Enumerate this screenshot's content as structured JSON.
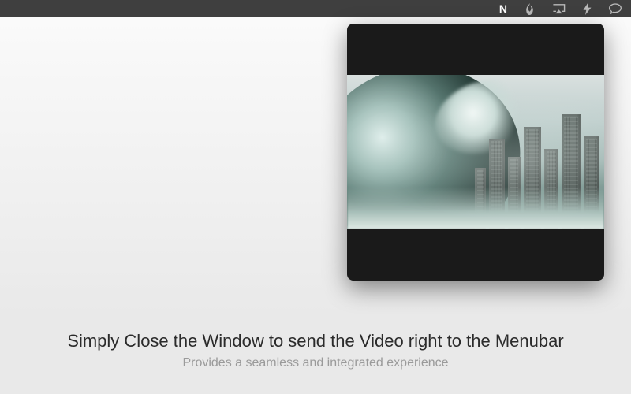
{
  "menubar": {
    "items": [
      {
        "name": "n-app-icon",
        "active": true
      },
      {
        "name": "flame-icon",
        "active": false
      },
      {
        "name": "airplay-icon",
        "active": false
      },
      {
        "name": "bolt-icon",
        "active": false
      },
      {
        "name": "chat-icon",
        "active": false
      }
    ]
  },
  "popover": {
    "thumbnail_alt": "tsunami wave approaching city skyline"
  },
  "captions": {
    "headline": "Simply Close the Window to send the Video right to the Menubar",
    "subhead": "Provides a seamless and integrated experience"
  }
}
